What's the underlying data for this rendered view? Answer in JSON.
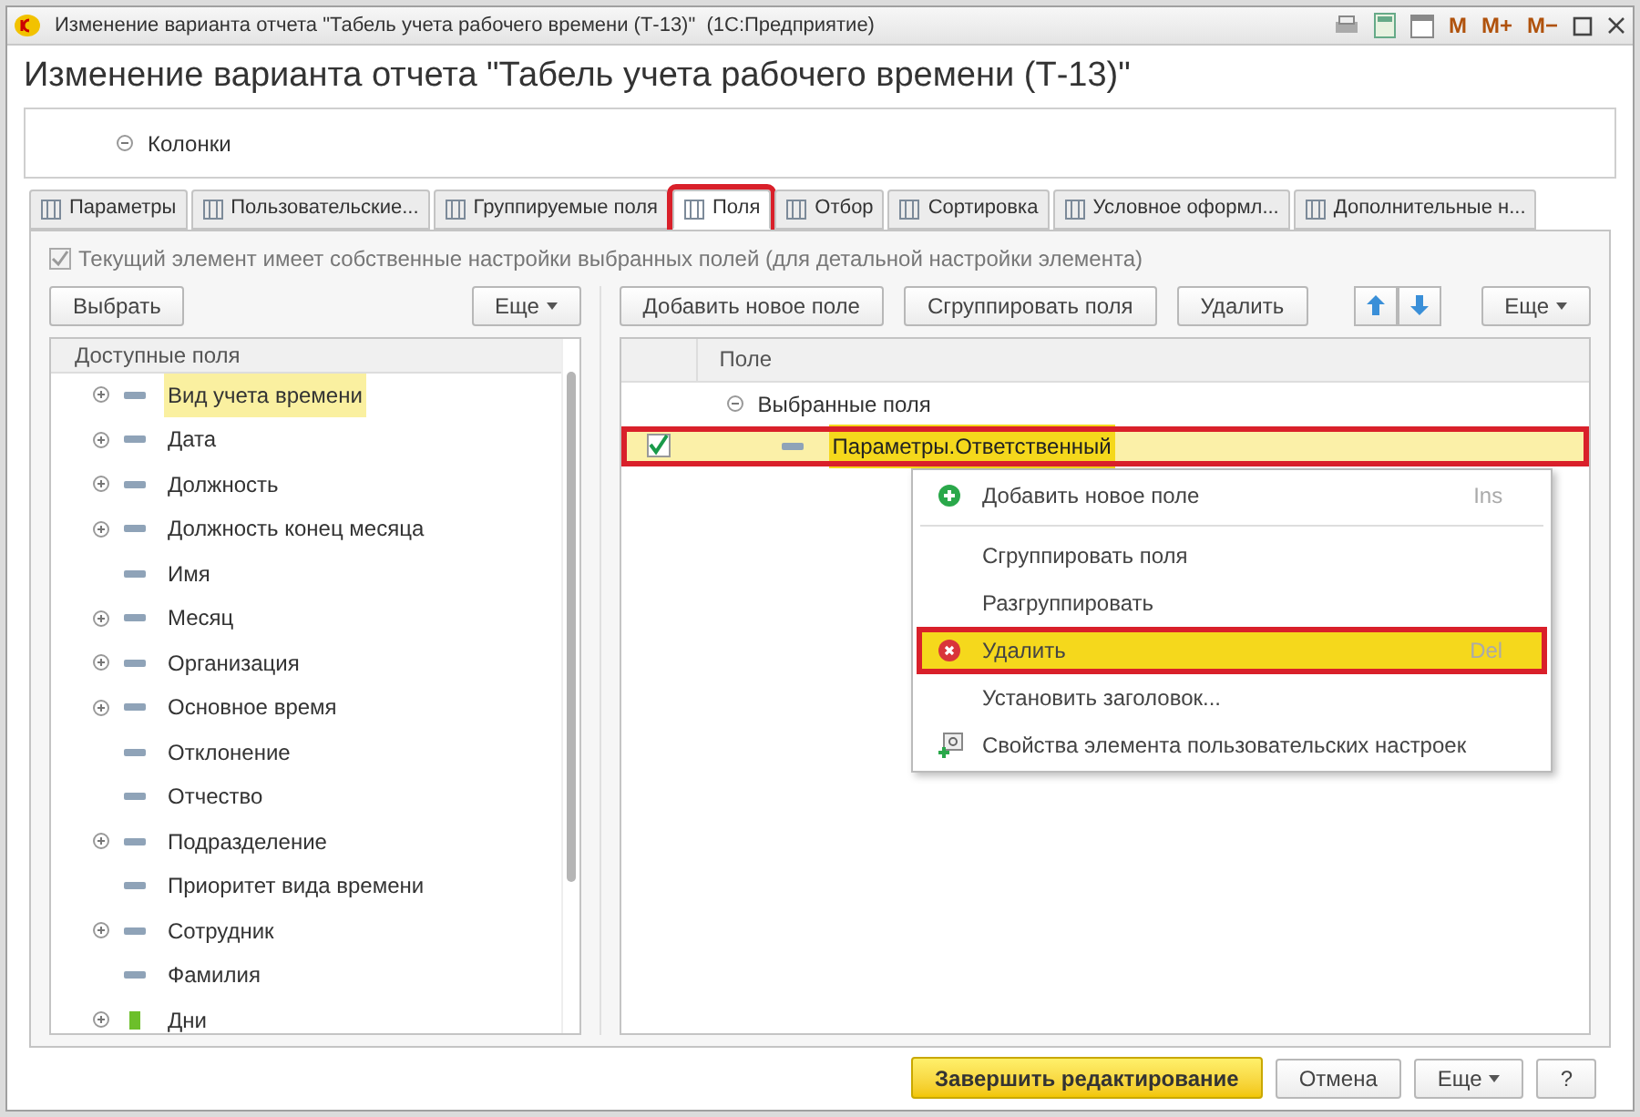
{
  "window": {
    "title": "Изменение варианта отчета \"Табель учета рабочего времени (Т-13)\"  (1С:Предприятие)",
    "tools": [
      "M",
      "M+",
      "M−"
    ]
  },
  "heading": "Изменение варианта отчета \"Табель учета рабочего времени (Т-13)\"",
  "structure": {
    "items": [
      {
        "label": "Колонки",
        "expanded": true
      }
    ]
  },
  "tabs": [
    {
      "label": "Параметры",
      "selected": false
    },
    {
      "label": "Пользовательские...",
      "selected": false
    },
    {
      "label": "Группируемые поля",
      "selected": false
    },
    {
      "label": "Поля",
      "selected": true
    },
    {
      "label": "Отбор",
      "selected": false
    },
    {
      "label": "Сортировка",
      "selected": false
    },
    {
      "label": "Условное оформл...",
      "selected": false
    },
    {
      "label": "Дополнительные н...",
      "selected": false
    }
  ],
  "own_settings": {
    "label": "Текущий элемент имеет собственные настройки выбранных полей (для детальной настройки элемента)",
    "checked": true,
    "disabled": true
  },
  "left_toolbar": {
    "select": "Выбрать",
    "more": "Еще"
  },
  "available_fields": {
    "header": "Доступные поля",
    "items": [
      {
        "label": "Вид учета времени",
        "expandable": true,
        "selected": true,
        "kind": "field"
      },
      {
        "label": "Дата",
        "expandable": true,
        "selected": false,
        "kind": "field"
      },
      {
        "label": "Должность",
        "expandable": true,
        "selected": false,
        "kind": "field"
      },
      {
        "label": "Должность конец месяца",
        "expandable": true,
        "selected": false,
        "kind": "field"
      },
      {
        "label": "Имя",
        "expandable": false,
        "selected": false,
        "kind": "field"
      },
      {
        "label": "Месяц",
        "expandable": true,
        "selected": false,
        "kind": "field"
      },
      {
        "label": "Организация",
        "expandable": true,
        "selected": false,
        "kind": "field"
      },
      {
        "label": "Основное время",
        "expandable": true,
        "selected": false,
        "kind": "field"
      },
      {
        "label": "Отклонение",
        "expandable": false,
        "selected": false,
        "kind": "field"
      },
      {
        "label": "Отчество",
        "expandable": false,
        "selected": false,
        "kind": "field"
      },
      {
        "label": "Подразделение",
        "expandable": true,
        "selected": false,
        "kind": "field"
      },
      {
        "label": "Приоритет вида времени",
        "expandable": false,
        "selected": false,
        "kind": "field"
      },
      {
        "label": "Сотрудник",
        "expandable": true,
        "selected": false,
        "kind": "field"
      },
      {
        "label": "Фамилия",
        "expandable": false,
        "selected": false,
        "kind": "field"
      },
      {
        "label": "Дни",
        "expandable": true,
        "selected": false,
        "kind": "resource"
      }
    ]
  },
  "right_toolbar": {
    "add": "Добавить новое поле",
    "group": "Сгруппировать поля",
    "delete": "Удалить",
    "more": "Еще"
  },
  "selected_fields": {
    "header": "Поле",
    "group": {
      "label": "Выбранные поля",
      "expanded": true,
      "children": [
        {
          "label": "Параметры.Ответственный",
          "checked": true,
          "selected": true
        }
      ]
    }
  },
  "context_menu": [
    {
      "label": "Добавить новое поле",
      "shortcut": "Ins",
      "kind": "add",
      "selected": false
    },
    {
      "kind": "separator"
    },
    {
      "label": "Сгруппировать поля",
      "kind": "plain",
      "selected": false
    },
    {
      "label": "Разгруппировать",
      "kind": "plain",
      "selected": false
    },
    {
      "label": "Удалить",
      "shortcut": "Del",
      "kind": "delete",
      "selected": true
    },
    {
      "label": "Установить заголовок...",
      "kind": "plain",
      "selected": false
    },
    {
      "label": "Свойства элемента пользовательских настроек",
      "kind": "settings",
      "selected": false
    }
  ],
  "footer": {
    "finish": "Завершить редактирование",
    "cancel": "Отмена",
    "more": "Еще",
    "help": "?"
  }
}
